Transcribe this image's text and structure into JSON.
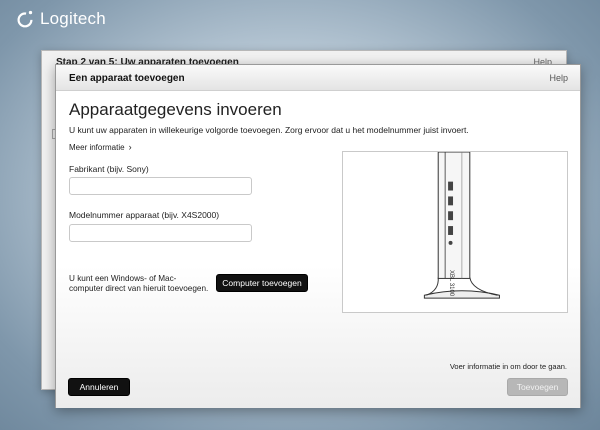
{
  "logo": {
    "text": "Logitech"
  },
  "back_window": {
    "title": "Stap 2 van 5: Uw apparaten toevoegen",
    "help": "Help"
  },
  "dialog": {
    "title": "Een apparaat toevoegen",
    "help": "Help",
    "heading": "Apparaatgegevens invoeren",
    "subtitle": "U kunt uw apparaten in willekeurige volgorde toevoegen. Zorg ervoor dat u het modelnummer juist invoert.",
    "more_info": "Meer informatie",
    "manufacturer": {
      "label": "Fabrikant  (bijv. Sony)",
      "value": ""
    },
    "model": {
      "label": "Modelnummer apparaat (bijv. X4S2000)",
      "value": ""
    },
    "windows_text": "U kunt een Windows- of Mac-computer direct van hieruit toevoegen.",
    "computer_button": "Computer toevoegen",
    "info_text": "Voer informatie in om door te gaan.",
    "cancel_button": "Annuleren",
    "add_button": "Toevoegen",
    "device_label": "XBL 3100"
  }
}
